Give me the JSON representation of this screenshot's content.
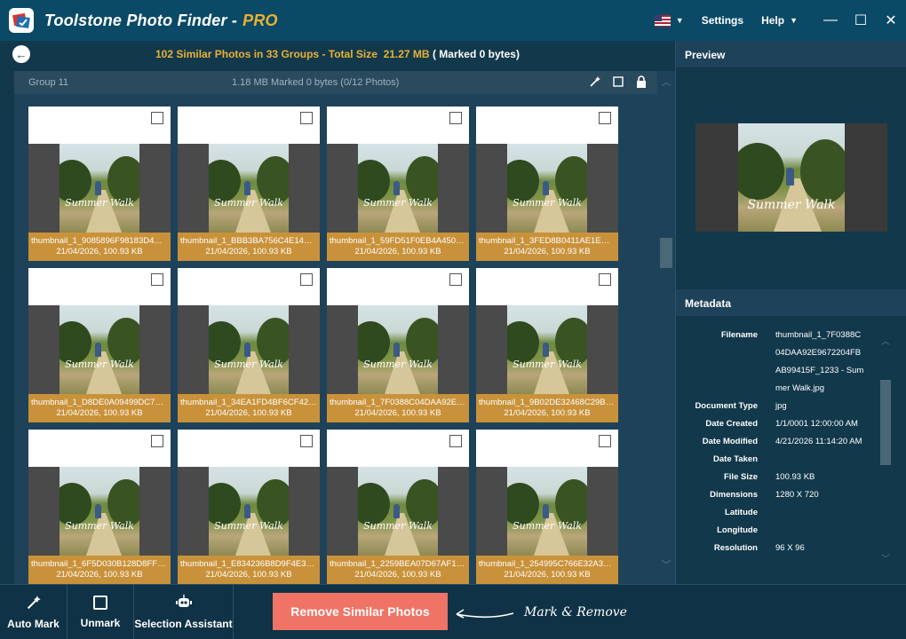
{
  "app": {
    "title": "Toolstone Photo Finder -",
    "edition": "PRO",
    "menu_settings": "Settings",
    "menu_help": "Help"
  },
  "summary": {
    "count": "102",
    "label_photos": "Similar Photos in",
    "groups": "33",
    "label_groups": "Groups - Total Size",
    "size": "21.27 MB",
    "marked": "( Marked 0 bytes)"
  },
  "group": {
    "name": "Group 11",
    "info": "1.18 MB Marked 0 bytes (0/12 Photos)"
  },
  "photos": [
    {
      "filename": "thumbnail_1_9085896F98183D4A2...",
      "meta": "21/04/2026, 100.93 KB"
    },
    {
      "filename": "thumbnail_1_BBB3BA756C4E14F05...",
      "meta": "21/04/2026, 100.93 KB"
    },
    {
      "filename": "thumbnail_1_59FD51F0EB4A4507C...",
      "meta": "21/04/2026, 100.93 KB"
    },
    {
      "filename": "thumbnail_1_3FED8B0411AE1EC1...",
      "meta": "21/04/2026, 100.93 KB"
    },
    {
      "filename": "thumbnail_1_D8DE0A09499DC76D...",
      "meta": "21/04/2026, 100.93 KB"
    },
    {
      "filename": "thumbnail_1_34EA1FD4BF6CF4271...",
      "meta": "21/04/2026, 100.93 KB"
    },
    {
      "filename": "thumbnail_1_7F0388C04DAA92E96...",
      "meta": "21/04/2026, 100.93 KB"
    },
    {
      "filename": "thumbnail_1_9B02DE32468C29B22...",
      "meta": "21/04/2026, 100.93 KB"
    },
    {
      "filename": "thumbnail_1_6F5D030B128D8FF8B...",
      "meta": "21/04/2026, 100.93 KB"
    },
    {
      "filename": "thumbnail_1_E834236B8D9F4E3444...",
      "meta": "21/04/2026, 100.93 KB"
    },
    {
      "filename": "thumbnail_1_2259BEA07D67AF12F...",
      "meta": "21/04/2026, 100.93 KB"
    },
    {
      "filename": "thumbnail_1_254995C766E32A3589...",
      "meta": "21/04/2026, 100.93 KB"
    }
  ],
  "photo_caption": "Summer Walk",
  "preview": {
    "title": "Preview"
  },
  "metadata": {
    "title": "Metadata",
    "rows": [
      {
        "key": "Filename",
        "value": "thumbnail_1_7F0388C04DAA92E9672204FBAB99415F_1233 - Summer Walk.jpg"
      },
      {
        "key": "Document Type",
        "value": "jpg"
      },
      {
        "key": "Date Created",
        "value": "1/1/0001 12:00:00 AM"
      },
      {
        "key": "Date Modified",
        "value": "4/21/2026 11:14:20 AM"
      },
      {
        "key": "Date Taken",
        "value": ""
      },
      {
        "key": "File Size",
        "value": "100.93 KB"
      },
      {
        "key": "Dimensions",
        "value": "1280 X 720"
      },
      {
        "key": "Latitude",
        "value": ""
      },
      {
        "key": "Longitude",
        "value": ""
      },
      {
        "key": "Resolution",
        "value": "96 X 96"
      }
    ]
  },
  "toolbar": {
    "auto_mark": "Auto Mark",
    "unmark": "Unmark",
    "selection_assistant": "Selection Assistant",
    "remove": "Remove Similar Photos",
    "hint": "Mark & Remove"
  },
  "colors": {
    "accent": "#e9b233",
    "card_footer": "#c9923a",
    "remove_button": "#ef7466",
    "titlebar": "#0b4a66"
  }
}
